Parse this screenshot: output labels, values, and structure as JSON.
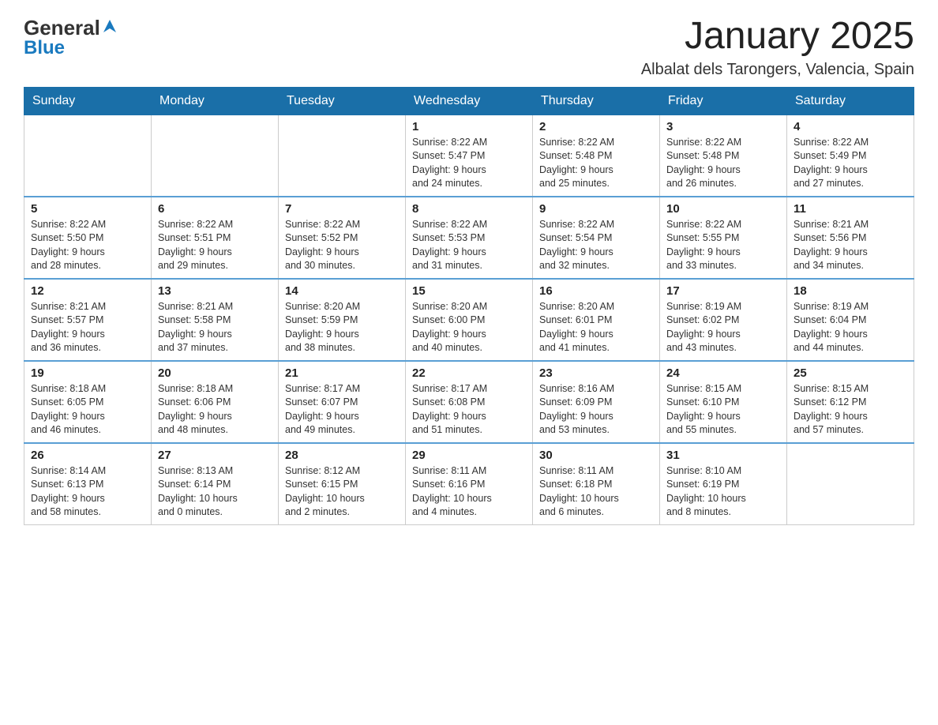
{
  "header": {
    "logo_general": "General",
    "logo_blue": "Blue",
    "main_title": "January 2025",
    "subtitle": "Albalat dels Tarongers, Valencia, Spain"
  },
  "calendar": {
    "days_of_week": [
      "Sunday",
      "Monday",
      "Tuesday",
      "Wednesday",
      "Thursday",
      "Friday",
      "Saturday"
    ],
    "weeks": [
      [
        {
          "day": "",
          "info": ""
        },
        {
          "day": "",
          "info": ""
        },
        {
          "day": "",
          "info": ""
        },
        {
          "day": "1",
          "info": "Sunrise: 8:22 AM\nSunset: 5:47 PM\nDaylight: 9 hours\nand 24 minutes."
        },
        {
          "day": "2",
          "info": "Sunrise: 8:22 AM\nSunset: 5:48 PM\nDaylight: 9 hours\nand 25 minutes."
        },
        {
          "day": "3",
          "info": "Sunrise: 8:22 AM\nSunset: 5:48 PM\nDaylight: 9 hours\nand 26 minutes."
        },
        {
          "day": "4",
          "info": "Sunrise: 8:22 AM\nSunset: 5:49 PM\nDaylight: 9 hours\nand 27 minutes."
        }
      ],
      [
        {
          "day": "5",
          "info": "Sunrise: 8:22 AM\nSunset: 5:50 PM\nDaylight: 9 hours\nand 28 minutes."
        },
        {
          "day": "6",
          "info": "Sunrise: 8:22 AM\nSunset: 5:51 PM\nDaylight: 9 hours\nand 29 minutes."
        },
        {
          "day": "7",
          "info": "Sunrise: 8:22 AM\nSunset: 5:52 PM\nDaylight: 9 hours\nand 30 minutes."
        },
        {
          "day": "8",
          "info": "Sunrise: 8:22 AM\nSunset: 5:53 PM\nDaylight: 9 hours\nand 31 minutes."
        },
        {
          "day": "9",
          "info": "Sunrise: 8:22 AM\nSunset: 5:54 PM\nDaylight: 9 hours\nand 32 minutes."
        },
        {
          "day": "10",
          "info": "Sunrise: 8:22 AM\nSunset: 5:55 PM\nDaylight: 9 hours\nand 33 minutes."
        },
        {
          "day": "11",
          "info": "Sunrise: 8:21 AM\nSunset: 5:56 PM\nDaylight: 9 hours\nand 34 minutes."
        }
      ],
      [
        {
          "day": "12",
          "info": "Sunrise: 8:21 AM\nSunset: 5:57 PM\nDaylight: 9 hours\nand 36 minutes."
        },
        {
          "day": "13",
          "info": "Sunrise: 8:21 AM\nSunset: 5:58 PM\nDaylight: 9 hours\nand 37 minutes."
        },
        {
          "day": "14",
          "info": "Sunrise: 8:20 AM\nSunset: 5:59 PM\nDaylight: 9 hours\nand 38 minutes."
        },
        {
          "day": "15",
          "info": "Sunrise: 8:20 AM\nSunset: 6:00 PM\nDaylight: 9 hours\nand 40 minutes."
        },
        {
          "day": "16",
          "info": "Sunrise: 8:20 AM\nSunset: 6:01 PM\nDaylight: 9 hours\nand 41 minutes."
        },
        {
          "day": "17",
          "info": "Sunrise: 8:19 AM\nSunset: 6:02 PM\nDaylight: 9 hours\nand 43 minutes."
        },
        {
          "day": "18",
          "info": "Sunrise: 8:19 AM\nSunset: 6:04 PM\nDaylight: 9 hours\nand 44 minutes."
        }
      ],
      [
        {
          "day": "19",
          "info": "Sunrise: 8:18 AM\nSunset: 6:05 PM\nDaylight: 9 hours\nand 46 minutes."
        },
        {
          "day": "20",
          "info": "Sunrise: 8:18 AM\nSunset: 6:06 PM\nDaylight: 9 hours\nand 48 minutes."
        },
        {
          "day": "21",
          "info": "Sunrise: 8:17 AM\nSunset: 6:07 PM\nDaylight: 9 hours\nand 49 minutes."
        },
        {
          "day": "22",
          "info": "Sunrise: 8:17 AM\nSunset: 6:08 PM\nDaylight: 9 hours\nand 51 minutes."
        },
        {
          "day": "23",
          "info": "Sunrise: 8:16 AM\nSunset: 6:09 PM\nDaylight: 9 hours\nand 53 minutes."
        },
        {
          "day": "24",
          "info": "Sunrise: 8:15 AM\nSunset: 6:10 PM\nDaylight: 9 hours\nand 55 minutes."
        },
        {
          "day": "25",
          "info": "Sunrise: 8:15 AM\nSunset: 6:12 PM\nDaylight: 9 hours\nand 57 minutes."
        }
      ],
      [
        {
          "day": "26",
          "info": "Sunrise: 8:14 AM\nSunset: 6:13 PM\nDaylight: 9 hours\nand 58 minutes."
        },
        {
          "day": "27",
          "info": "Sunrise: 8:13 AM\nSunset: 6:14 PM\nDaylight: 10 hours\nand 0 minutes."
        },
        {
          "day": "28",
          "info": "Sunrise: 8:12 AM\nSunset: 6:15 PM\nDaylight: 10 hours\nand 2 minutes."
        },
        {
          "day": "29",
          "info": "Sunrise: 8:11 AM\nSunset: 6:16 PM\nDaylight: 10 hours\nand 4 minutes."
        },
        {
          "day": "30",
          "info": "Sunrise: 8:11 AM\nSunset: 6:18 PM\nDaylight: 10 hours\nand 6 minutes."
        },
        {
          "day": "31",
          "info": "Sunrise: 8:10 AM\nSunset: 6:19 PM\nDaylight: 10 hours\nand 8 minutes."
        },
        {
          "day": "",
          "info": ""
        }
      ]
    ]
  }
}
